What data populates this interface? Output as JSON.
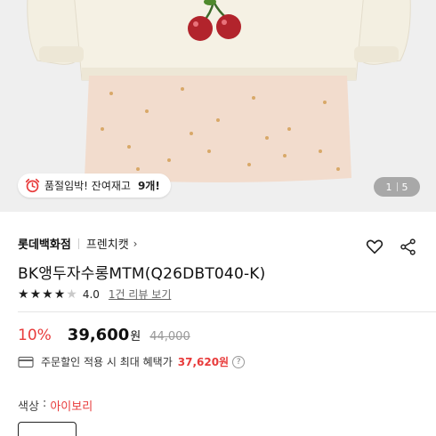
{
  "hero": {
    "stock_notice": "품절임박! 잔여재고",
    "stock_count": "9개!",
    "pager_current": "1",
    "pager_total": "5"
  },
  "product": {
    "store": "롯데백화점",
    "brand": "프렌치캣",
    "brand_chevron": "›",
    "title": "BK앵두자수롱MTM(Q26DBT040-K)",
    "rating": {
      "stars_filled": 4,
      "stars_total": 5,
      "score": "4.0",
      "reviews_link": "1건 리뷰 보기"
    },
    "price": {
      "discount": "10%",
      "sale_price": "39,600",
      "currency": "원",
      "original_price": "44,000"
    },
    "benefit": {
      "text": "주문할인 적용 시 최대 혜택가",
      "amount": "37,620원",
      "help": "?"
    },
    "option": {
      "label": "색상",
      "colon": ":",
      "value": "아이보리"
    }
  },
  "colors": {
    "accent_red": "#e83b3b",
    "sweater_ivory": "#f3efe1",
    "skirt_peach": "#f2dccd"
  },
  "icons": [
    "alarm-clock-icon",
    "heart-icon",
    "share-icon",
    "card-icon",
    "help-icon"
  ]
}
